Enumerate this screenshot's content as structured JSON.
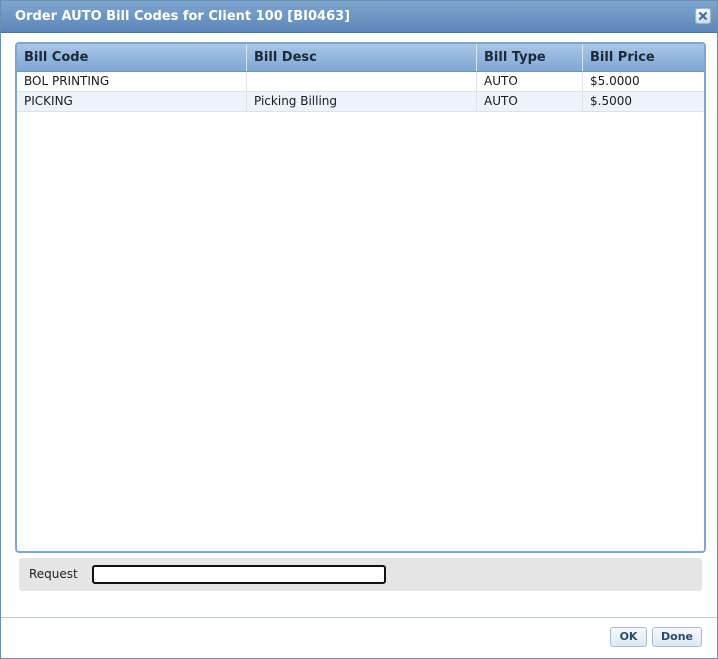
{
  "dialog": {
    "title": "Order AUTO Bill Codes for Client 100 [BI0463]"
  },
  "grid": {
    "columns": [
      "Bill Code",
      "Bill Desc",
      "Bill Type",
      "Bill Price"
    ],
    "rows": [
      [
        "BOL PRINTING",
        "",
        "AUTO",
        "$5.0000"
      ],
      [
        "PICKING",
        "Picking Billing",
        "AUTO",
        "$.5000"
      ]
    ]
  },
  "request": {
    "label": "Request",
    "value": ""
  },
  "buttons": {
    "ok": "OK",
    "done": "Done"
  },
  "icons": {
    "close": "close-icon"
  },
  "colors": {
    "titlebar": "#5b86b8",
    "grid_border": "#7fa6ce",
    "alt_row": "#eef2fa"
  }
}
